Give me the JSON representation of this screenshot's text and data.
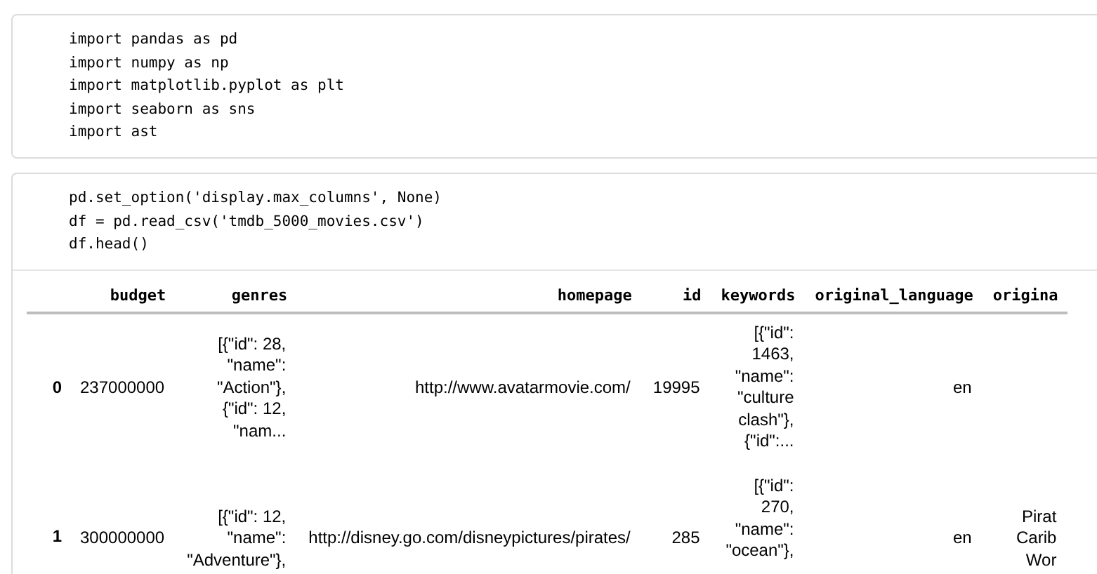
{
  "cells": [
    {
      "kind": "code",
      "source": [
        "import pandas as pd",
        "import numpy as np",
        "import matplotlib.pyplot as plt",
        "import seaborn as sns",
        "import ast"
      ]
    },
    {
      "kind": "code",
      "source": [
        "pd.set_option('display.max_columns', None)",
        "df = pd.read_csv('tmdb_5000_movies.csv')",
        "df.head()"
      ],
      "output": {
        "table": {
          "columns": [
            "budget",
            "genres",
            "homepage",
            "id",
            "keywords",
            "original_language",
            "origina"
          ],
          "rows": [
            {
              "index": "0",
              "cells": [
                [
                  "237000000"
                ],
                [
                  "[{\"id\": 28,",
                  "\"name\":",
                  "\"Action\"},",
                  "{\"id\": 12,",
                  "\"nam..."
                ],
                [
                  "http://www.avatarmovie.com/"
                ],
                [
                  "19995"
                ],
                [
                  "[{\"id\":",
                  "1463,",
                  "\"name\":",
                  "\"culture",
                  "clash\"},",
                  "{\"id\":..."
                ],
                [
                  "en"
                ],
                []
              ]
            },
            {
              "index": "1",
              "cells": [
                [
                  "300000000"
                ],
                [
                  "[{\"id\": 12,",
                  "\"name\":",
                  "\"Adventure\"},"
                ],
                [
                  "http://disney.go.com/disneypictures/pirates/"
                ],
                [
                  "285"
                ],
                [
                  "[{\"id\":",
                  "270,",
                  "\"name\":",
                  "\"ocean\"},"
                ],
                [
                  "en"
                ],
                [
                  "Pirat",
                  "Carib",
                  "Wor"
                ]
              ]
            }
          ]
        }
      }
    }
  ]
}
